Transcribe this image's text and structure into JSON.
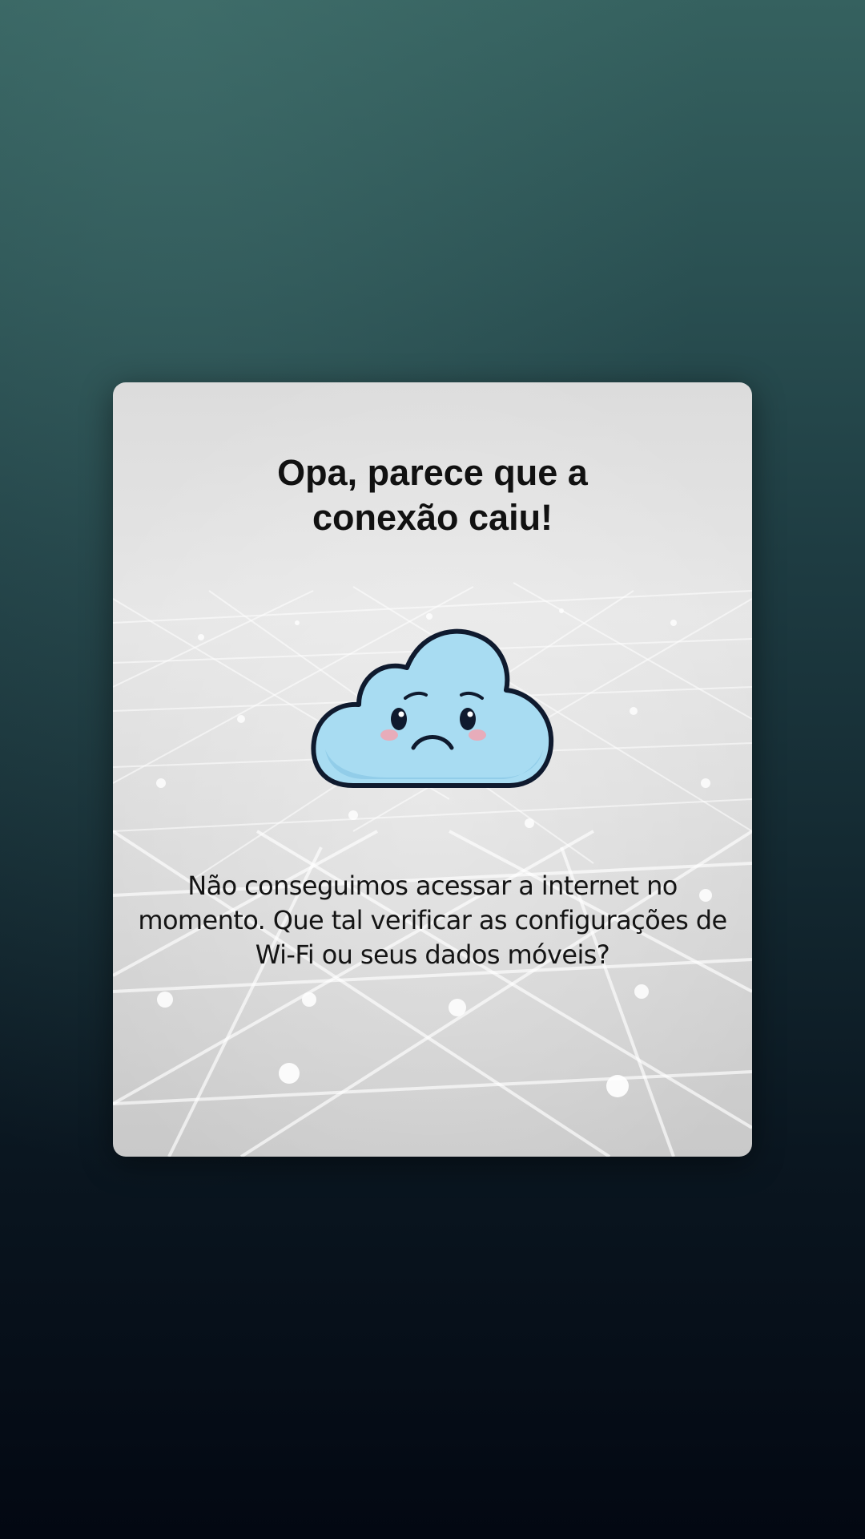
{
  "dialog": {
    "title": "Opa, parece que a conexão caiu!",
    "message": "Não conseguimos acessar a internet no momento. Que tal verificar as configurações de Wi-Fi ou seus dados móveis?",
    "illustration_icon": "sad-cloud-icon"
  },
  "colors": {
    "background_top": "#35615f",
    "background_bottom": "#030812",
    "card_background": "#e0e0e0",
    "cloud_fill": "#a8dcf2",
    "cloud_outline": "#0f1a2e",
    "text": "#111111"
  }
}
